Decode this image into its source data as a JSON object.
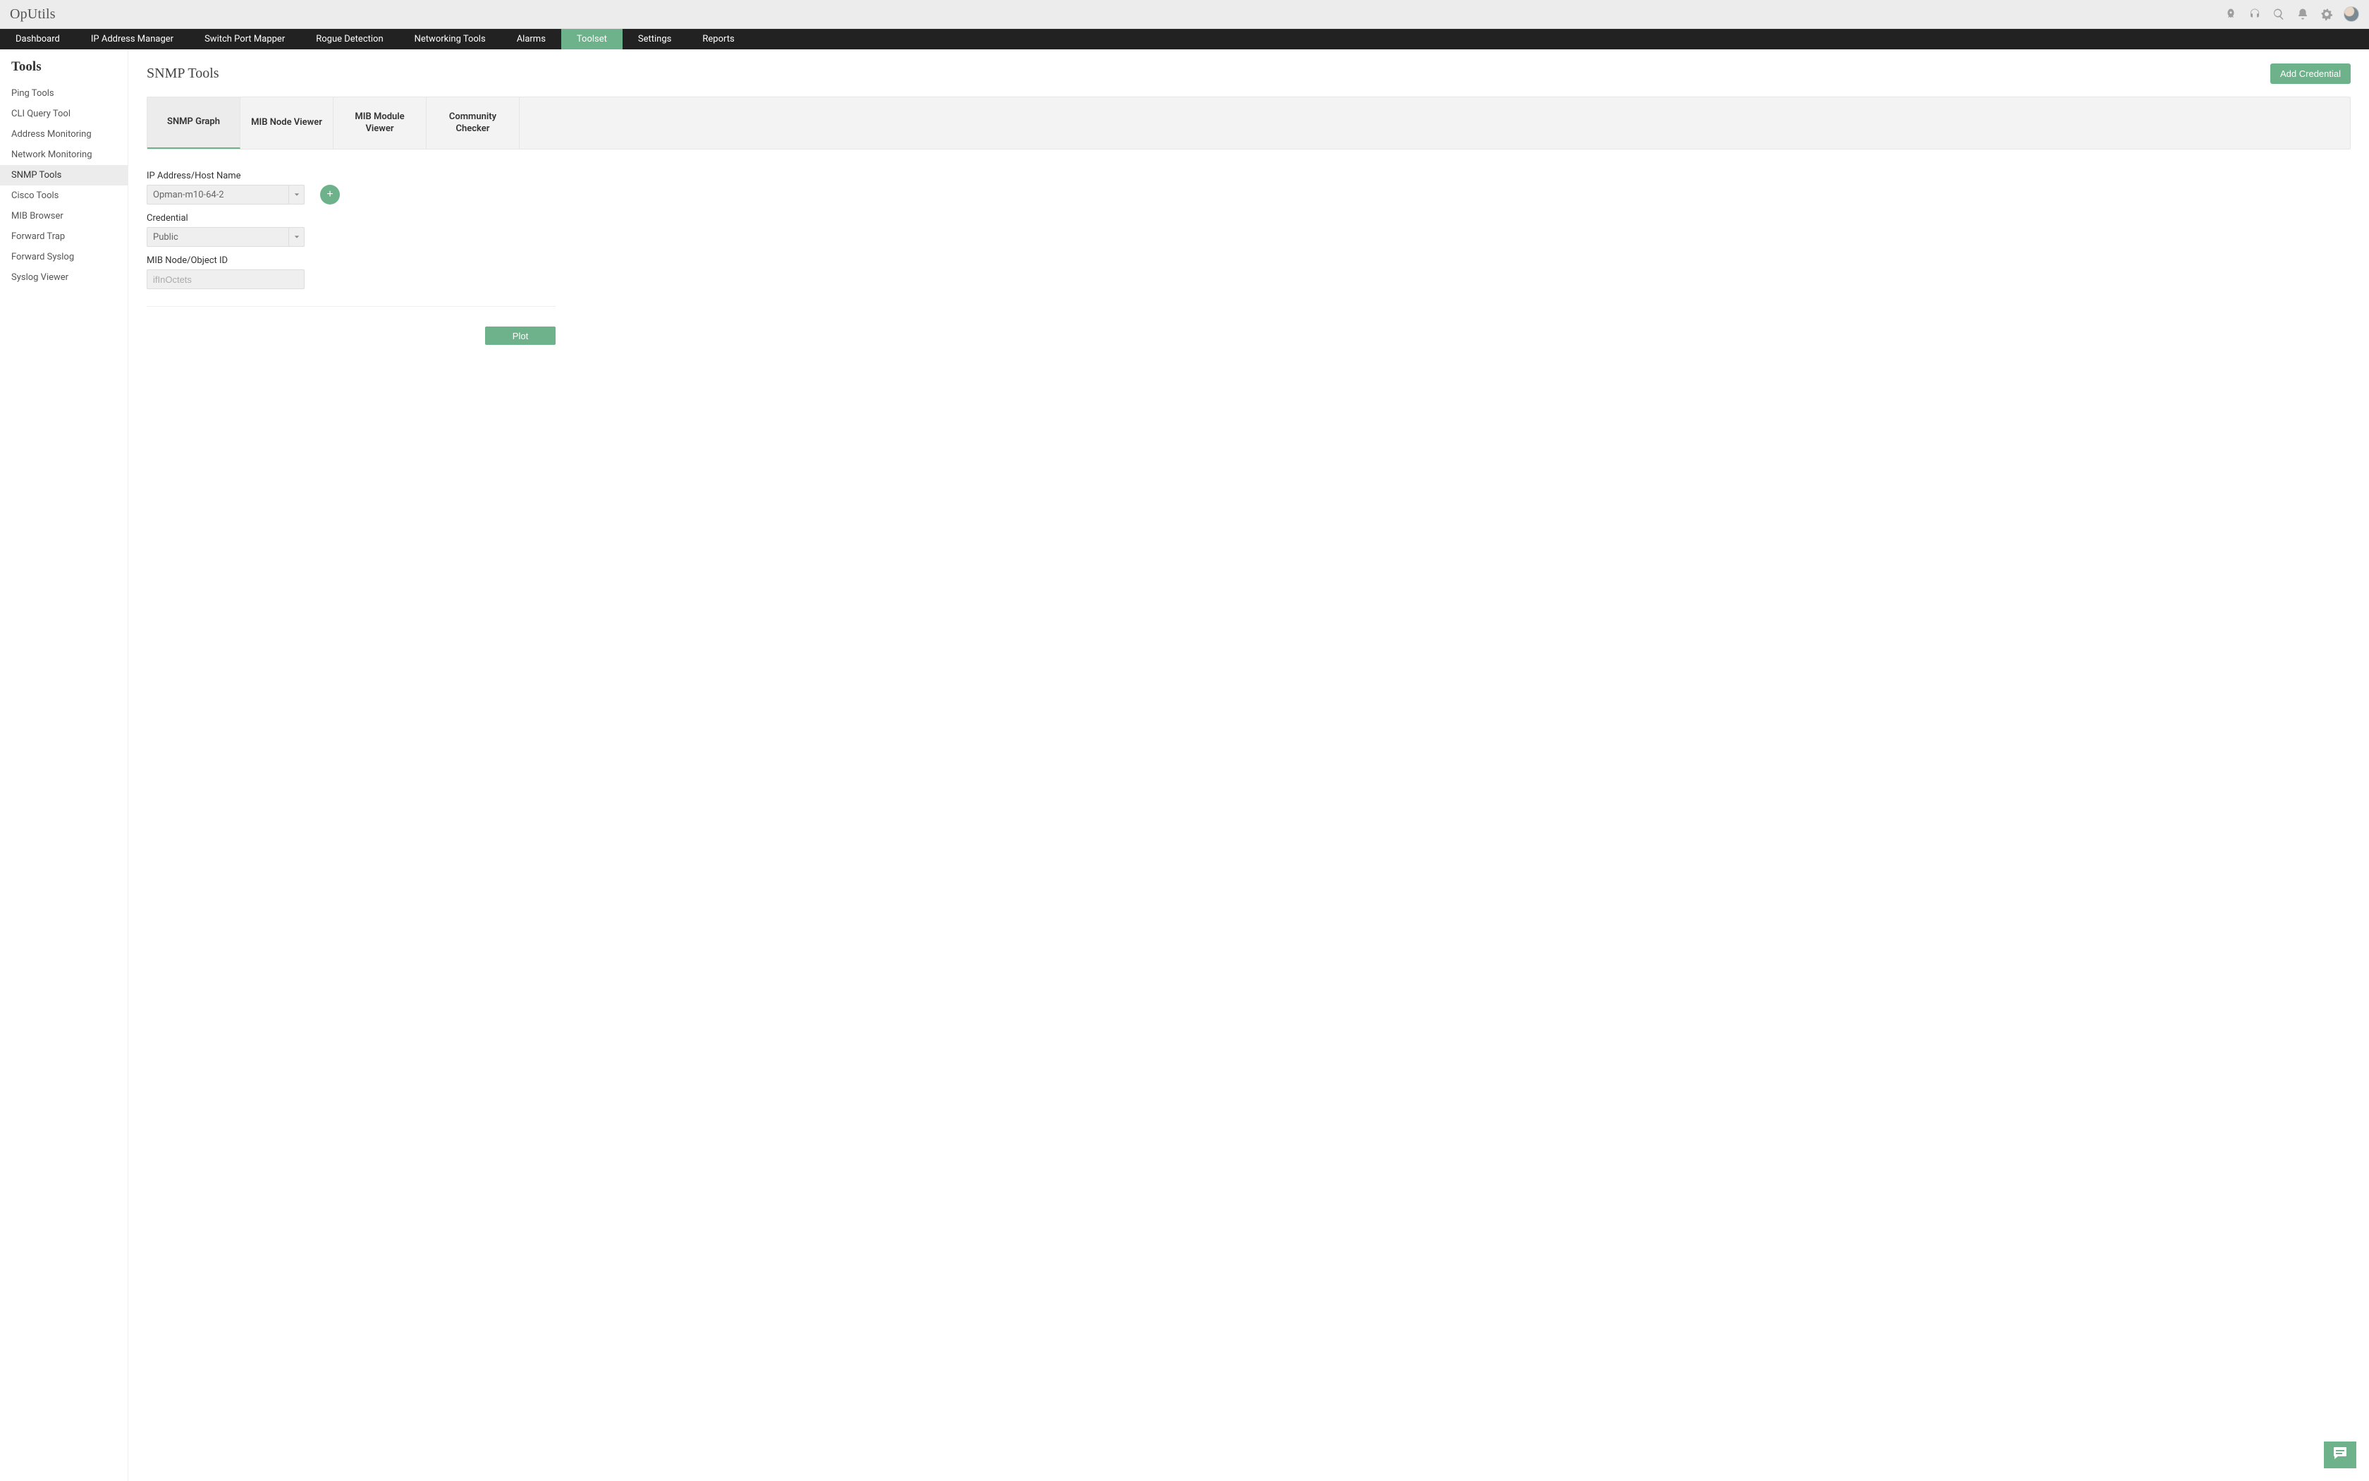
{
  "brand": "OpUtils",
  "topIcons": [
    "rocket-icon",
    "headset-icon",
    "search-icon",
    "bell-icon",
    "gear-icon"
  ],
  "mainnav": [
    {
      "label": "Dashboard",
      "active": false
    },
    {
      "label": "IP Address Manager",
      "active": false
    },
    {
      "label": "Switch Port Mapper",
      "active": false
    },
    {
      "label": "Rogue Detection",
      "active": false
    },
    {
      "label": "Networking Tools",
      "active": false
    },
    {
      "label": "Alarms",
      "active": false
    },
    {
      "label": "Toolset",
      "active": true
    },
    {
      "label": "Settings",
      "active": false
    },
    {
      "label": "Reports",
      "active": false
    }
  ],
  "sidebar": {
    "title": "Tools",
    "items": [
      {
        "label": "Ping Tools",
        "active": false
      },
      {
        "label": "CLI Query Tool",
        "active": false
      },
      {
        "label": "Address Monitoring",
        "active": false
      },
      {
        "label": "Network Monitoring",
        "active": false
      },
      {
        "label": "SNMP Tools",
        "active": true
      },
      {
        "label": "Cisco Tools",
        "active": false
      },
      {
        "label": "MIB Browser",
        "active": false
      },
      {
        "label": "Forward Trap",
        "active": false
      },
      {
        "label": "Forward Syslog",
        "active": false
      },
      {
        "label": "Syslog Viewer",
        "active": false
      }
    ]
  },
  "page": {
    "title": "SNMP Tools",
    "addCredentialLabel": "Add Credential"
  },
  "tabs": [
    {
      "label": "SNMP Graph",
      "active": true
    },
    {
      "label": "MIB Node Viewer",
      "active": false
    },
    {
      "label": "MIB Module Viewer",
      "active": false
    },
    {
      "label": "Community Checker",
      "active": false
    }
  ],
  "form": {
    "ipLabel": "IP Address/Host Name",
    "ipValue": "Opman-m10-64-2",
    "credentialLabel": "Credential",
    "credentialValue": "Public",
    "mibLabel": "MIB Node/Object ID",
    "mibPlaceholder": "ifInOctets",
    "plotLabel": "Plot",
    "addHostLabel": "+"
  }
}
